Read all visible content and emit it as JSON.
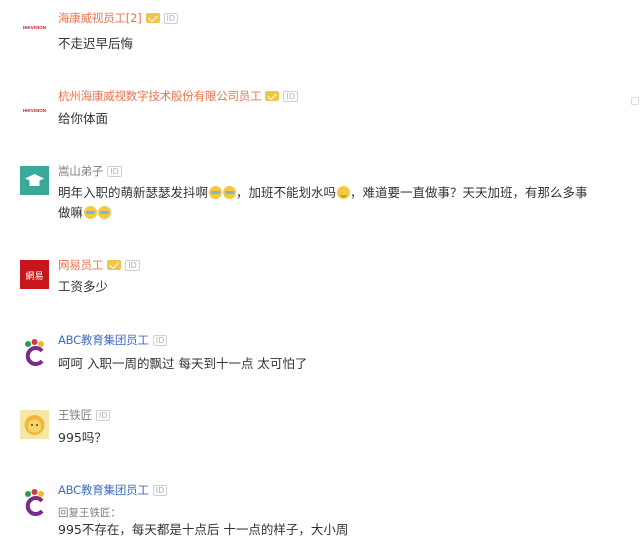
{
  "comments": [
    {
      "name": "海康威视员工[2]",
      "text": "不走迟早后悔",
      "avatar_text": "HIKVISION"
    },
    {
      "name": "杭州海康威视数字技术股份有限公司员工",
      "text": "给你体面",
      "avatar_text": "HIKVISION"
    },
    {
      "name": "嵩山弟子",
      "text_a": "明年入职的萌新瑟瑟发抖啊",
      "text_b": "，加班不能划水吗",
      "text_c": "，难道要一直做事？天天加班，有那么多事",
      "text_d": "做嘛"
    },
    {
      "name": "网易员工",
      "text": "工资多少",
      "avatar_text": "網易"
    },
    {
      "name": "ABC教育集团员工",
      "text": "呵呵 入职一周的飘过 每天到十一点 太可怕了"
    },
    {
      "name": "王铁匠",
      "text": "995吗？"
    },
    {
      "name": "ABC教育集团员工",
      "reply_to": "回复王铁匠：",
      "text": "995不存在，每天都是十点后 十一点的样子，大小周"
    }
  ],
  "badges": {
    "id": "ID"
  },
  "colors": {
    "name_orange": "#eb7350",
    "name_gray": "#808080",
    "text": "#333333",
    "v_badge": "#f0c54a"
  }
}
